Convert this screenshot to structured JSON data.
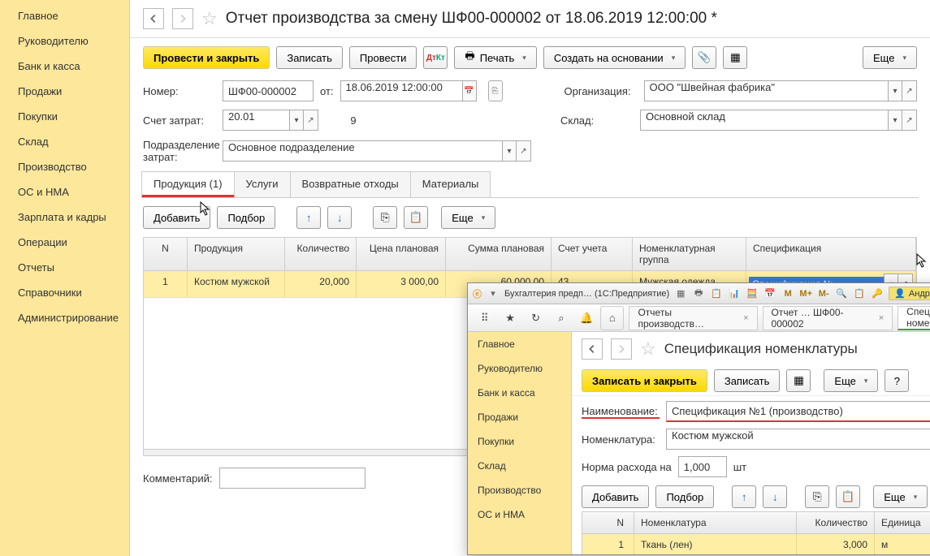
{
  "sidebar": {
    "items": [
      "Главное",
      "Руководителю",
      "Банк и касса",
      "Продажи",
      "Покупки",
      "Склад",
      "Производство",
      "ОС и НМА",
      "Зарплата и кадры",
      "Операции",
      "Отчеты",
      "Справочники",
      "Администрирование"
    ]
  },
  "header": {
    "title": "Отчет производства за смену ШФ00-000002 от 18.06.2019 12:00:00 *"
  },
  "toolbar": {
    "post_close": "Провести и закрыть",
    "write": "Записать",
    "post": "Провести",
    "print": "Печать",
    "create_based": "Создать на основании",
    "more": "Еще"
  },
  "form": {
    "number_label": "Номер:",
    "number": "ШФ00-000002",
    "from_label": "от:",
    "date": "18.06.2019 12:00:00",
    "org_label": "Организация:",
    "org": "ООО \"Швейная фабрика\"",
    "cost_acc_label": "Счет затрат:",
    "cost_acc": "20.01",
    "cost_code": "9",
    "warehouse_label": "Склад:",
    "warehouse": "Основной склад",
    "dept_label": "Подразделение затрат:",
    "dept": "Основное подразделение"
  },
  "tabs": [
    "Продукция (1)",
    "Услуги",
    "Возвратные отходы",
    "Материалы"
  ],
  "table_toolbar": {
    "add": "Добавить",
    "select": "Подбор",
    "more": "Еще"
  },
  "columns": {
    "n": "N",
    "product": "Продукция",
    "qty": "Количество",
    "price": "Цена плановая",
    "sum": "Сумма плановая",
    "account": "Счет учета",
    "nom_group": "Номенклатурная группа",
    "spec": "Спецификация"
  },
  "rows": [
    {
      "n": "1",
      "product": "Костюм мужской",
      "qty": "20,000",
      "price": "3 000,00",
      "sum": "60 000,00",
      "account": "43",
      "nom_group": "Мужская одежда",
      "spec": "Спецификация №"
    }
  ],
  "comment_label": "Комментарий:",
  "sub": {
    "titlebar_app": "Бухгалтерия предп… (1С:Предприятие)",
    "user": "Андрей",
    "memory": {
      "m": "M",
      "mp": "M+",
      "mm": "M-"
    },
    "tab1": "Отчеты производств…",
    "tab2": "Отчет … ШФ00-000002",
    "tab3": "Спецификация номе…",
    "sidebar_items": [
      "Главное",
      "Руководителю",
      "Банк и касса",
      "Продажи",
      "Покупки",
      "Склад",
      "Производство",
      "ОС и НМА"
    ],
    "title": "Спецификация номенклатуры",
    "toolbar": {
      "write_close": "Записать и закрыть",
      "write": "Записать",
      "more": "Еще"
    },
    "name_label": "Наименование:",
    "name": "Спецификация №1 (производство)",
    "nom_label": "Номенклатура:",
    "nom": "Костюм мужской",
    "norm_label": "Норма расхода на",
    "norm_value": "1,000",
    "norm_unit": "шт",
    "tbl_toolbar": {
      "add": "Добавить",
      "select": "Подбор",
      "more": "Еще"
    },
    "columns": {
      "n": "N",
      "nom": "Номенклатура",
      "qty": "Количество",
      "unit": "Единица"
    },
    "rows": [
      {
        "n": "1",
        "nom": "Ткань (лен)",
        "qty": "3,000",
        "unit": "м"
      }
    ]
  }
}
